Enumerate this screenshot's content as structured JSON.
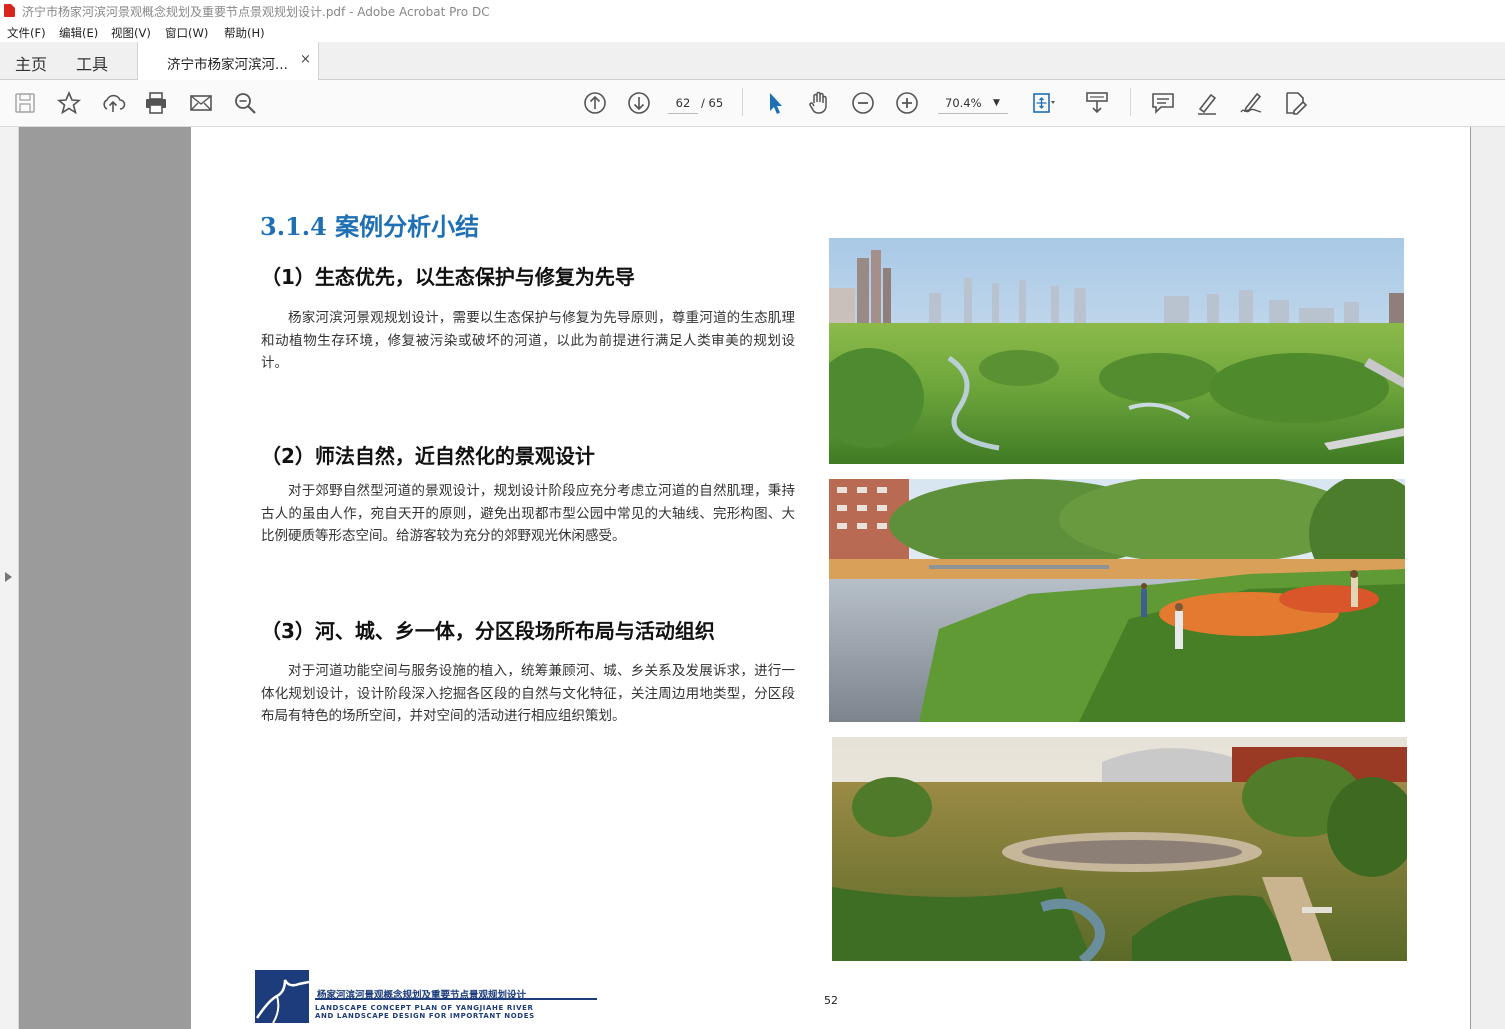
{
  "window": {
    "title": "济宁市杨家河滨河景观概念规划及重要节点景观规划设计.pdf - Adobe Acrobat Pro DC"
  },
  "menu": [
    "文件(F)",
    "编辑(E)",
    "视图(V)",
    "窗口(W)",
    "帮助(H)"
  ],
  "tabs": {
    "home": "主页",
    "tools": "工具",
    "document": "济宁市杨家河滨河...",
    "close": "×"
  },
  "toolbar": {
    "icons": [
      "save-icon",
      "bookmark-star-icon",
      "upload-icon",
      "print-icon",
      "email-icon",
      "search-zoom-icon",
      "page-up-icon",
      "page-down-icon",
      "select-arrow-icon",
      "hand-icon",
      "zoom-out-icon",
      "zoom-in-icon",
      "fit-page-icon",
      "scroll-mode-icon",
      "comment-icon",
      "highlight-icon",
      "sign-icon",
      "edit-pdf-icon"
    ],
    "current_page": "62",
    "total_pages": "/ 65",
    "zoom": "70.4%"
  },
  "document": {
    "section_title": "3.1.4 案例分析小结",
    "sections": [
      {
        "heading": "（1）生态优先，以生态保护与修复为先导",
        "body": "杨家河滨河景观规划设计，需要以生态保护与修复为先导原则，尊重河道的生态肌理和动植物生存环境，修复被污染或破坏的河道，以此为前提进行满足人类审美的规划设计。"
      },
      {
        "heading": "（2）师法自然，近自然化的景观设计",
        "body": "对于郊野自然型河道的景观设计，规划设计阶段应充分考虑立河道的自然肌理，秉持古人的虽由人作，宛自天开的原则，避免出现都市型公园中常见的大轴线、完形构图、大比例硬质等形态空间。给游客较为充分的郊野观光休闲感受。"
      },
      {
        "heading": "（3）河、城、乡一体，分区段场所布局与活动组织",
        "body": "对于河道功能空间与服务设施的植入，统筹兼顾河、城、乡关系及发展诉求，进行一体化规划设计，设计阶段深入挖掘各区段的自然与文化特征，关注周边用地类型，分区段布局有特色的场所空间，并对空间的活动进行相应组织策划。"
      }
    ],
    "page_number": "52",
    "footer": {
      "cn": "杨家河滨河景观概念规划及重要节点景观规划设计",
      "en_line1": "LANDSCAPE CONCEPT PLAN OF YANGJIAHE RIVER",
      "en_line2": "AND LANDSCAPE DESIGN FOR IMPORTANT NODES"
    }
  },
  "colors": {
    "accent": "#1e6fb3",
    "footer": "#1d3c7b",
    "pdf_red": "#d8261f"
  }
}
